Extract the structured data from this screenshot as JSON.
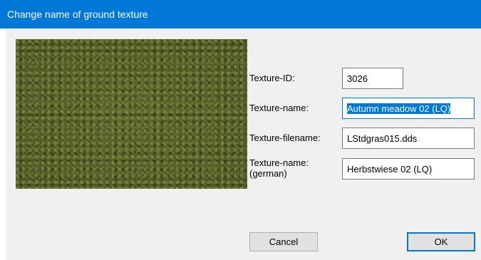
{
  "window": {
    "title": "Change name of ground texture"
  },
  "preview": {
    "icon": "grass-texture-image"
  },
  "form": {
    "texture_id": {
      "label": "Texture-ID:",
      "value": "3026"
    },
    "texture_name": {
      "label": "Texture-name:",
      "value": "Autumn meadow 02 (LQ)"
    },
    "texture_filename": {
      "label": "Texture-filename:",
      "value": "LStdgras015.dds"
    },
    "texture_name_german": {
      "label_line1": "Texture-name:",
      "label_line2": "(german)",
      "value": "Herbstwiese 02 (LQ)"
    }
  },
  "buttons": {
    "cancel_label": "Cancel",
    "ok_label": "OK"
  },
  "colors": {
    "titlebar": "#0078d7",
    "selection": "#0078d7",
    "dialog_background": "#f0f0f0"
  }
}
